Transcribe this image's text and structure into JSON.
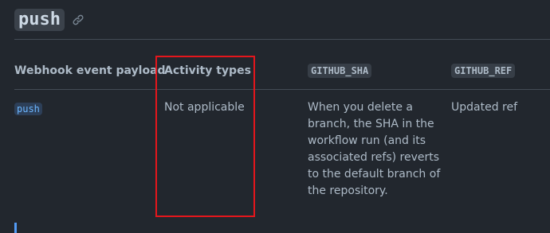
{
  "heading": {
    "event_name": "push"
  },
  "table": {
    "columns": [
      "Webhook event payload",
      "Activity types",
      "GITHUB_SHA",
      "GITHUB_REF"
    ],
    "rows": [
      {
        "payload": "push",
        "activity_types": "Not applicable",
        "github_sha": "When you delete a branch, the SHA in the workflow run (and its associated refs) reverts to the default branch of the repository.",
        "github_ref": "Updated ref"
      }
    ]
  },
  "icons": {
    "anchor": "link-icon"
  },
  "colors": {
    "background": "#22272e",
    "text": "#adbac7",
    "link": "#6cb6ff",
    "highlight": "#e5161c",
    "accent": "#539bf5"
  }
}
